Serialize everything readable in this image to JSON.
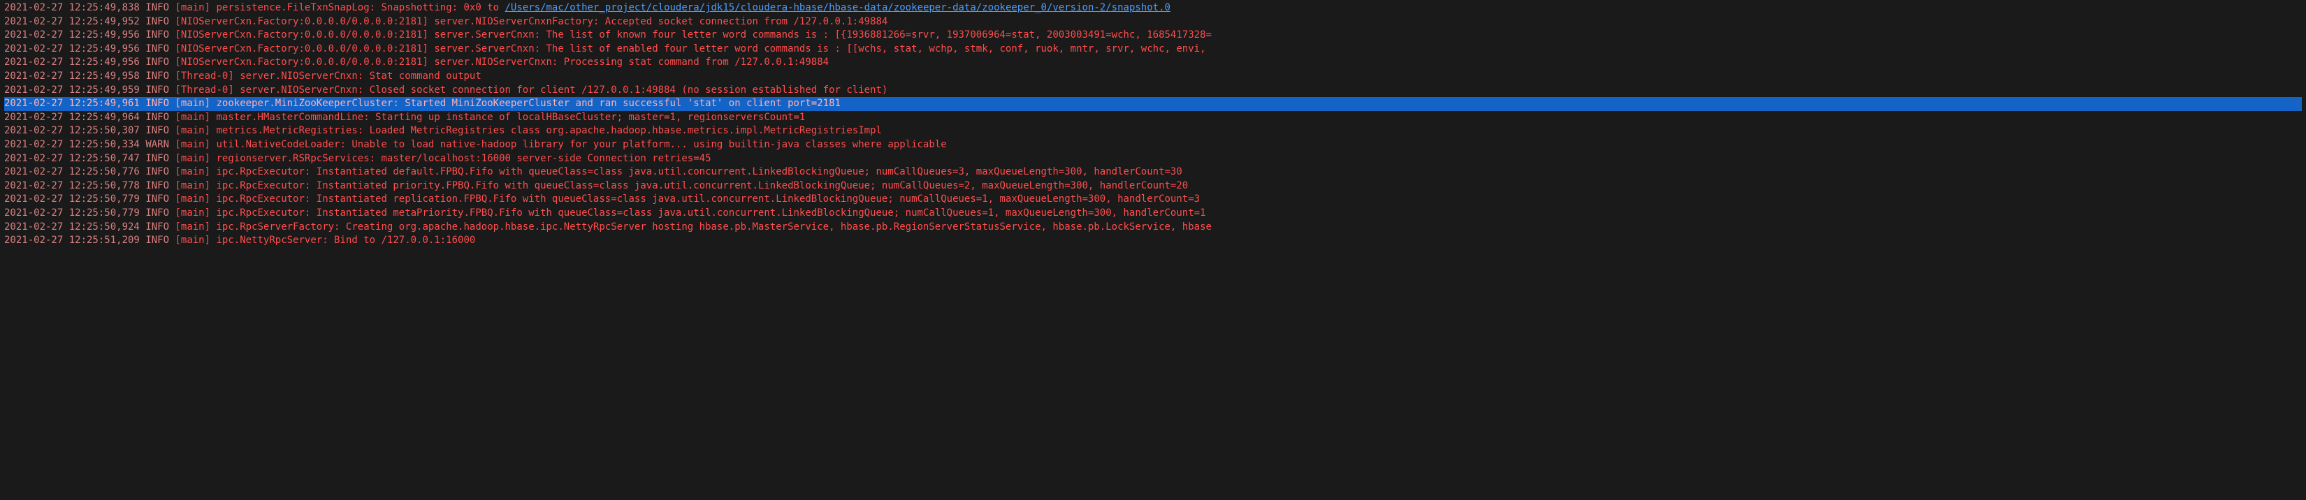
{
  "lines": [
    {
      "ts": "2021-02-27 12:25:49,838",
      "level": "INFO",
      "thread": "[main]",
      "msgPrefix": "persistence.FileTxnSnapLog: Snapshotting: 0x0 to ",
      "link": "/Users/mac/other_project/cloudera/jdk15/cloudera-hbase/hbase-data/zookeeper-data/zookeeper_0/version-2/snapshot.0",
      "msgSuffix": "",
      "highlighted": false
    },
    {
      "ts": "2021-02-27 12:25:49,952",
      "level": "INFO",
      "thread": "[NIOServerCxn.Factory:0.0.0.0/0.0.0.0:2181]",
      "msgPrefix": "server.NIOServerCnxnFactory: Accepted socket connection from /127.0.0.1:49884",
      "link": "",
      "msgSuffix": "",
      "highlighted": false
    },
    {
      "ts": "2021-02-27 12:25:49,956",
      "level": "INFO",
      "thread": "[NIOServerCxn.Factory:0.0.0.0/0.0.0.0:2181]",
      "msgPrefix": "server.ServerCnxn: The list of known four letter word commands is : [{1936881266=srvr, 1937006964=stat, 2003003491=wchc, 1685417328=",
      "link": "",
      "msgSuffix": "",
      "highlighted": false
    },
    {
      "ts": "2021-02-27 12:25:49,956",
      "level": "INFO",
      "thread": "[NIOServerCxn.Factory:0.0.0.0/0.0.0.0:2181]",
      "msgPrefix": "server.ServerCnxn: The list of enabled four letter word commands is : [[wchs, stat, wchp, stmk, conf, ruok, mntr, srvr, wchc, envi,",
      "link": "",
      "msgSuffix": "",
      "highlighted": false
    },
    {
      "ts": "2021-02-27 12:25:49,956",
      "level": "INFO",
      "thread": "[NIOServerCxn.Factory:0.0.0.0/0.0.0.0:2181]",
      "msgPrefix": "server.NIOServerCnxn: Processing stat command from /127.0.0.1:49884",
      "link": "",
      "msgSuffix": "",
      "highlighted": false
    },
    {
      "ts": "2021-02-27 12:25:49,958",
      "level": "INFO",
      "thread": "[Thread-0]",
      "msgPrefix": "server.NIOServerCnxn: Stat command output",
      "link": "",
      "msgSuffix": "",
      "highlighted": false
    },
    {
      "ts": "2021-02-27 12:25:49,959",
      "level": "INFO",
      "thread": "[Thread-0]",
      "msgPrefix": "server.NIOServerCnxn: Closed socket connection for client /127.0.0.1:49884 (no session established for client)",
      "link": "",
      "msgSuffix": "",
      "highlighted": false
    },
    {
      "ts": "2021-02-27 12:25:49,961",
      "level": "INFO",
      "thread": "[main]",
      "msgPrefix": "zookeeper.MiniZooKeeperCluster: Started MiniZooKeeperCluster and ran successful 'stat' on client port=2181",
      "link": "",
      "msgSuffix": "",
      "highlighted": true
    },
    {
      "ts": "2021-02-27 12:25:49,964",
      "level": "INFO",
      "thread": "[main]",
      "msgPrefix": "master.HMasterCommandLine: Starting up instance of localHBaseCluster; master=1, regionserversCount=1",
      "link": "",
      "msgSuffix": "",
      "highlighted": false
    },
    {
      "ts": "2021-02-27 12:25:50,307",
      "level": "INFO",
      "thread": "[main]",
      "msgPrefix": "metrics.MetricRegistries: Loaded MetricRegistries class org.apache.hadoop.hbase.metrics.impl.MetricRegistriesImpl",
      "link": "",
      "msgSuffix": "",
      "highlighted": false
    },
    {
      "ts": "2021-02-27 12:25:50,334",
      "level": "WARN",
      "thread": "[main]",
      "msgPrefix": "util.NativeCodeLoader: Unable to load native-hadoop library for your platform... using builtin-java classes where applicable",
      "link": "",
      "msgSuffix": "",
      "highlighted": false
    },
    {
      "ts": "2021-02-27 12:25:50,747",
      "level": "INFO",
      "thread": "[main]",
      "msgPrefix": "regionserver.RSRpcServices: master/localhost:16000 server-side Connection retries=45",
      "link": "",
      "msgSuffix": "",
      "highlighted": false
    },
    {
      "ts": "2021-02-27 12:25:50,776",
      "level": "INFO",
      "thread": "[main]",
      "msgPrefix": "ipc.RpcExecutor: Instantiated default.FPBQ.Fifo with queueClass=class java.util.concurrent.LinkedBlockingQueue; numCallQueues=3, maxQueueLength=300, handlerCount=30",
      "link": "",
      "msgSuffix": "",
      "highlighted": false
    },
    {
      "ts": "2021-02-27 12:25:50,778",
      "level": "INFO",
      "thread": "[main]",
      "msgPrefix": "ipc.RpcExecutor: Instantiated priority.FPBQ.Fifo with queueClass=class java.util.concurrent.LinkedBlockingQueue; numCallQueues=2, maxQueueLength=300, handlerCount=20",
      "link": "",
      "msgSuffix": "",
      "highlighted": false
    },
    {
      "ts": "2021-02-27 12:25:50,779",
      "level": "INFO",
      "thread": "[main]",
      "msgPrefix": "ipc.RpcExecutor: Instantiated replication.FPBQ.Fifo with queueClass=class java.util.concurrent.LinkedBlockingQueue; numCallQueues=1, maxQueueLength=300, handlerCount=3",
      "link": "",
      "msgSuffix": "",
      "highlighted": false
    },
    {
      "ts": "2021-02-27 12:25:50,779",
      "level": "INFO",
      "thread": "[main]",
      "msgPrefix": "ipc.RpcExecutor: Instantiated metaPriority.FPBQ.Fifo with queueClass=class java.util.concurrent.LinkedBlockingQueue; numCallQueues=1, maxQueueLength=300, handlerCount=1",
      "link": "",
      "msgSuffix": "",
      "highlighted": false
    },
    {
      "ts": "2021-02-27 12:25:50,924",
      "level": "INFO",
      "thread": "[main]",
      "msgPrefix": "ipc.RpcServerFactory: Creating org.apache.hadoop.hbase.ipc.NettyRpcServer hosting hbase.pb.MasterService, hbase.pb.RegionServerStatusService, hbase.pb.LockService, hbase",
      "link": "",
      "msgSuffix": "",
      "highlighted": false
    },
    {
      "ts": "2021-02-27 12:25:51,209",
      "level": "INFO",
      "thread": "[main]",
      "msgPrefix": "ipc.NettyRpcServer: Bind to /127.0.0.1:16000",
      "link": "",
      "msgSuffix": "",
      "highlighted": false
    }
  ]
}
